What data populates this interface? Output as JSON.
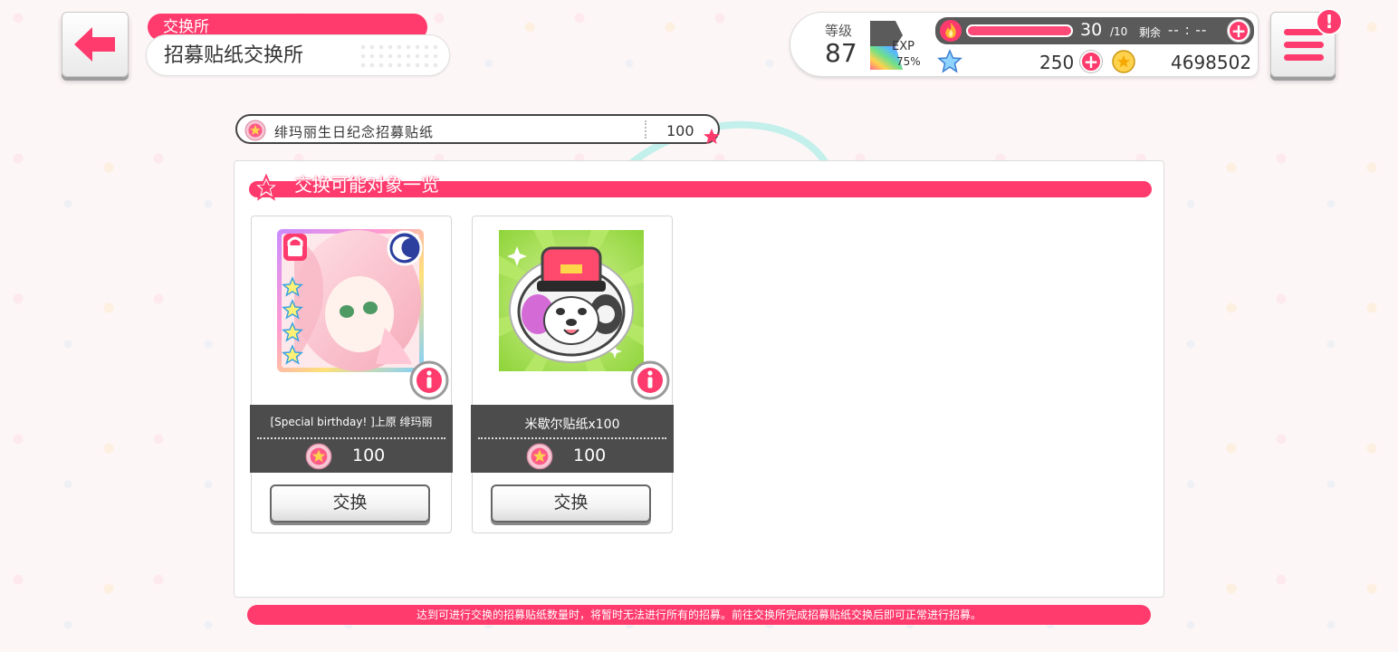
{
  "header": {
    "category": "交换所",
    "title": "招募贴纸交换所"
  },
  "status": {
    "level_label": "等级",
    "level": "87",
    "exp_label": "EXP",
    "exp_percent": "75%",
    "stamina": "30",
    "stamina_max": "/10",
    "remaining_label": "剩余",
    "remaining_time": "-- : --",
    "star_gems": "250",
    "coins": "4698502"
  },
  "sticker": {
    "name": "绯玛丽生日纪念招募贴纸",
    "count": "100"
  },
  "section": {
    "title": "交换可能对象一览"
  },
  "items": [
    {
      "name": "[Special birthday! ]上原 绯玛丽",
      "cost": "100",
      "button": "交换"
    },
    {
      "name": "米歇尔贴纸x100",
      "cost": "100",
      "button": "交换"
    }
  ],
  "notice": "达到可进行交换的招募贴纸数量时，将暂时无法进行所有的招募。前往交换所完成招募贴纸交换后即可正常进行招募。",
  "colors": {
    "accent": "#ff3b6d",
    "dark_band": "#4c4c4c",
    "background": "#fdf6f7"
  },
  "icons": [
    "back-arrow-icon",
    "exp-icon",
    "flame-icon",
    "plus-icon",
    "star-icon",
    "coin-icon",
    "menu-icon",
    "alert-badge-icon",
    "sticker-icon",
    "info-icon"
  ]
}
